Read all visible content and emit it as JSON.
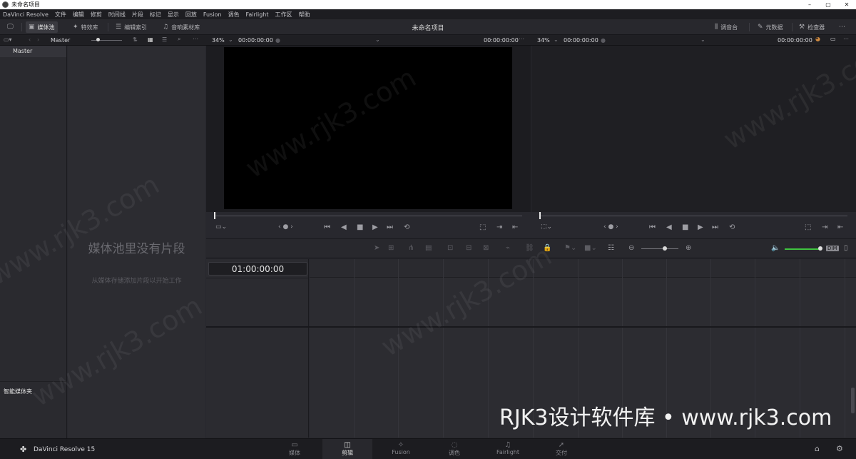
{
  "window": {
    "title": "未命名项目",
    "minimize": "–",
    "maximize": "▢",
    "close": "✕"
  },
  "menu": [
    "DaVinci Resolve",
    "文件",
    "编辑",
    "修剪",
    "时间线",
    "片段",
    "标记",
    "显示",
    "回放",
    "Fusion",
    "调色",
    "Fairlight",
    "工作区",
    "帮助"
  ],
  "toolbar": {
    "media_pool": "媒体池",
    "effects": "特效库",
    "edit_index": "编辑索引",
    "sound_library": "音响素材库",
    "project_title": "未命名项目",
    "mixer": "调音台",
    "metadata": "元数据",
    "inspector": "检查器"
  },
  "subbar": {
    "bin_name": "Master",
    "left_zoom": "34%",
    "left_tc_start": "00:00:00:00",
    "left_tc_end": "00:00:00:00",
    "right_zoom": "34%",
    "right_tc_start": "00:00:00:00",
    "right_tc_end": "00:00:00:00"
  },
  "bins": {
    "master": "Master",
    "smart_bins": "智能媒体夹"
  },
  "media_pool": {
    "empty_title": "媒体池里没有片段",
    "empty_sub": "从媒体存储添加片段以开始工作"
  },
  "timeline": {
    "timecode": "01:00:00:00",
    "audio_meter": "DIM"
  },
  "bottom": {
    "app_name": "DaVinci Resolve 15",
    "pages": [
      {
        "label": "媒体",
        "icon": "▭"
      },
      {
        "label": "剪辑",
        "icon": "◫"
      },
      {
        "label": "Fusion",
        "icon": "✧"
      },
      {
        "label": "调色",
        "icon": "◌"
      },
      {
        "label": "Fairlight",
        "icon": "♫"
      },
      {
        "label": "交付",
        "icon": "➚"
      }
    ]
  },
  "watermark": {
    "text": "www.rjk3.com",
    "banner": "RJK3设计软件库 • www.rjk3.com"
  }
}
